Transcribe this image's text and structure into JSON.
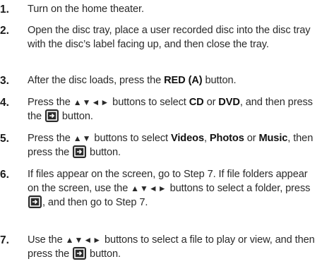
{
  "steps": [
    {
      "number": "1.",
      "text": "Turn on the home theater."
    },
    {
      "number": "2.",
      "text": "Open the disc tray, place a user recorded disc into the disc tray with the disc’s label facing up, and then close the tray."
    },
    {
      "number": "3.",
      "pre": "After the disc loads,  press the ",
      "bold": "RED (A)",
      "post": " button."
    },
    {
      "number": "4.",
      "pre": "Press the ",
      "arrows": "▲▼◄►",
      "mid": " buttons to select ",
      "b1": "CD",
      "or": " or ",
      "b2": "DVD",
      "end": ", and then press the ",
      "end2": " button.",
      "icon": "enter-icon"
    },
    {
      "number": "5.",
      "pre": "Press the ",
      "arrows": "▲▼",
      "mid": " buttons to select ",
      "b1": "Videos",
      "c1": ", ",
      "b2": "Photos",
      "or": " or ",
      "b3": "Music",
      "end": ", then press the ",
      "end2": " button.",
      "icon": "enter-icon"
    },
    {
      "number": "6.",
      "pre": "If files appear on the screen, go to Step 7. If file folders appear on the screen, use the ",
      "arrows": "▲▼◄►",
      "mid": " buttons to select a folder, press ",
      "end": ", and then go to Step 7.",
      "icon": "enter-icon"
    },
    {
      "number": "7.",
      "pre": "Use the ",
      "arrows": "▲▼◄►",
      "mid": " buttons to select a file to play or view, and then press the ",
      "end": " button.",
      "icon": "enter-icon"
    }
  ]
}
